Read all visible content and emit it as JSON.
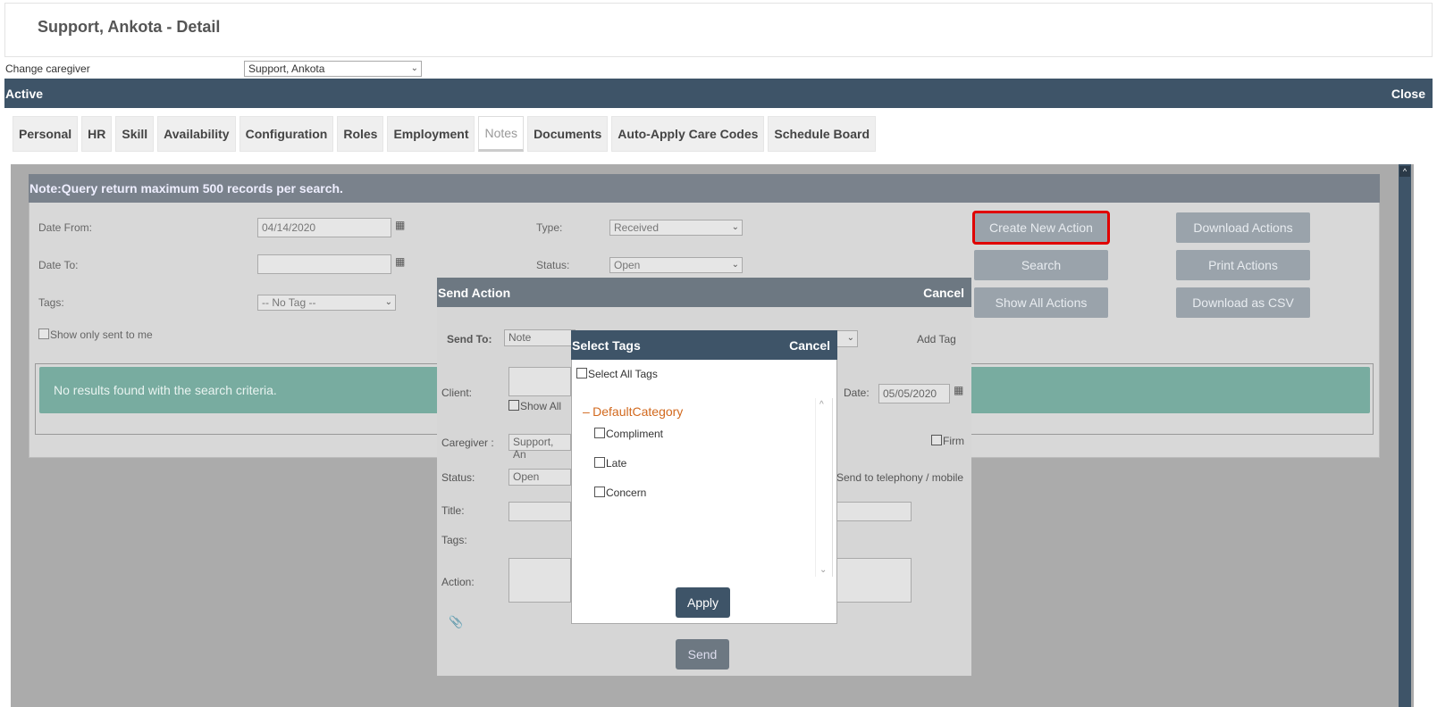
{
  "page": {
    "title": "Support, Ankota - Detail"
  },
  "caregiver": {
    "label": "Change caregiver",
    "selected": "Support, Ankota"
  },
  "statusbar": {
    "status": "Active",
    "close": "Close"
  },
  "tabs": [
    "Personal",
    "HR",
    "Skill",
    "Availability",
    "Configuration",
    "Roles",
    "Employment",
    "Notes",
    "Documents",
    "Auto-Apply Care Codes",
    "Schedule Board"
  ],
  "notes": {
    "banner": "Note:Query return maximum 500 records per search.",
    "date_from_label": "Date From:",
    "date_from": "04/14/2020",
    "date_to_label": "Date To:",
    "date_to": "",
    "tags_label": "Tags:",
    "tags_value": "-- No Tag --",
    "type_label": "Type:",
    "type_value": "Received",
    "status_label": "Status:",
    "status_value": "Open",
    "show_only_sent": "Show only sent to me",
    "buttons": {
      "create": "Create New Action",
      "download_actions": "Download Actions",
      "search": "Search",
      "print": "Print Actions",
      "show_all": "Show All Actions",
      "download_csv": "Download as CSV"
    },
    "no_results": "No results found with the search criteria."
  },
  "send_action": {
    "title": "Send Action",
    "cancel": "Cancel",
    "send_to_label": "Send To:",
    "send_to": "Note",
    "add_tag": "Add Tag",
    "client_label": "Client:",
    "show_all": "Show All",
    "date_label": "Date:",
    "date": "05/05/2020",
    "caregiver_label": "Caregiver :",
    "caregiver": "Support, An",
    "firm": "Firm",
    "status_label": "Status:",
    "status": "Open",
    "telephony": "Send to telephony / mobile",
    "title_label": "Title:",
    "tags_label": "Tags:",
    "action_label": "Action:",
    "send": "Send"
  },
  "select_tags": {
    "title": "Select Tags",
    "cancel": "Cancel",
    "select_all": "Select All Tags",
    "category_toggle": "–",
    "category": "DefaultCategory",
    "items": [
      "Compliment",
      "Late",
      "Concern"
    ],
    "apply": "Apply"
  },
  "colors": {
    "header_bar": "#3e5468",
    "highlight": "#e00000",
    "category": "#d2691e",
    "no_result_bg": "#78aca0"
  }
}
